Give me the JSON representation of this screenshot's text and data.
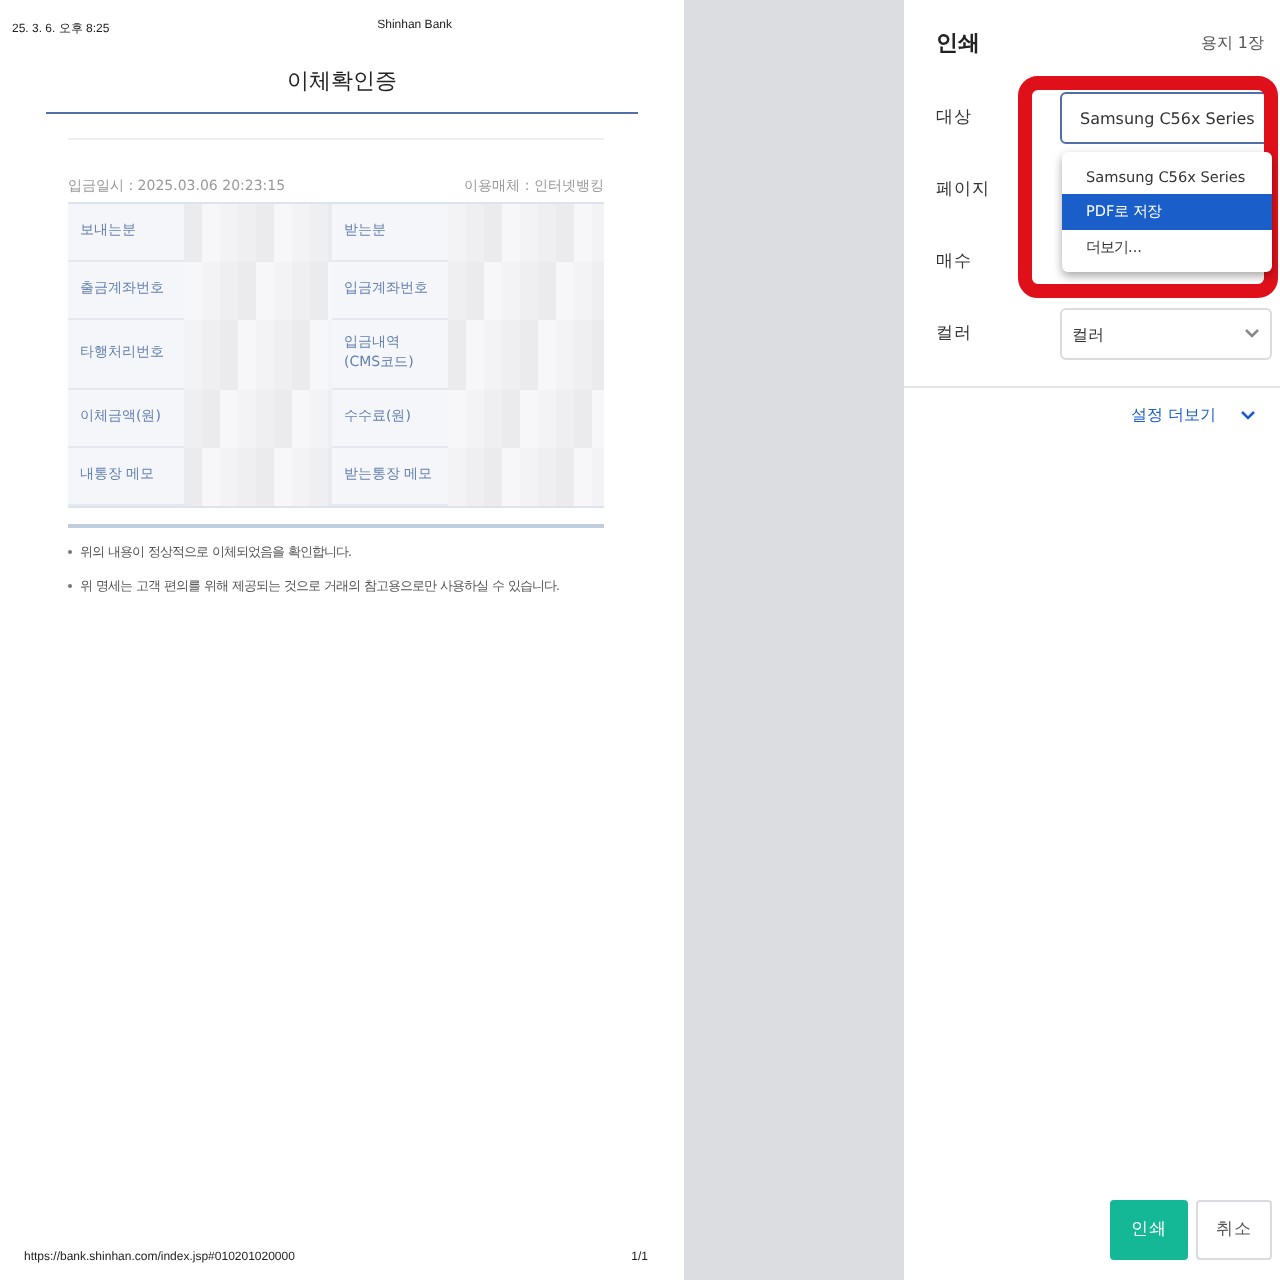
{
  "preview": {
    "header_left": "25. 3. 6. 오후 8:25",
    "header_center": "Shinhan Bank",
    "title": "이체확인증",
    "date_line": "입금일시 : 2025.03.06 20:23:15",
    "channel_line": "이용매체 : 인터넷뱅킹",
    "rows": [
      {
        "left": "보내는분",
        "right": "받는분"
      },
      {
        "left": "출금계좌번호",
        "right": "입금계좌번호"
      },
      {
        "left": "타행처리번호",
        "right": "입금내역\n(CMS코드)"
      },
      {
        "left": "이체금액(원)",
        "right": "수수료(원)"
      },
      {
        "left": "내통장 메모",
        "right": "받는통장 메모"
      }
    ],
    "notes": [
      "위의 내용이 정상적으로 이체되었음을 확인합니다.",
      "위 명세는 고객 편의를 위해 제공되는 것으로 거래의 참고용으로만 사용하실 수 있습니다."
    ],
    "footer_url": "https://bank.shinhan.com/index.jsp#010201020000",
    "footer_page": "1/1"
  },
  "dialog": {
    "title": "인쇄",
    "sheets": "용지 1장",
    "fields": [
      {
        "label": "대상",
        "kind": "destination",
        "value": "Samsung C56x Series"
      },
      {
        "label": "페이지",
        "kind": "covered"
      },
      {
        "label": "매수",
        "kind": "covered"
      },
      {
        "label": "컬러",
        "kind": "select",
        "value": "컬러"
      }
    ],
    "dropdown": [
      {
        "label": "Samsung C56x Series",
        "selected": false
      },
      {
        "label": "PDF로 저장",
        "selected": true
      },
      {
        "label": "더보기...",
        "selected": false
      }
    ],
    "more_settings": "설정 더보기",
    "buttons": [
      {
        "label": "인쇄",
        "kind": "primary"
      },
      {
        "label": "취소",
        "kind": "secondary"
      }
    ]
  }
}
